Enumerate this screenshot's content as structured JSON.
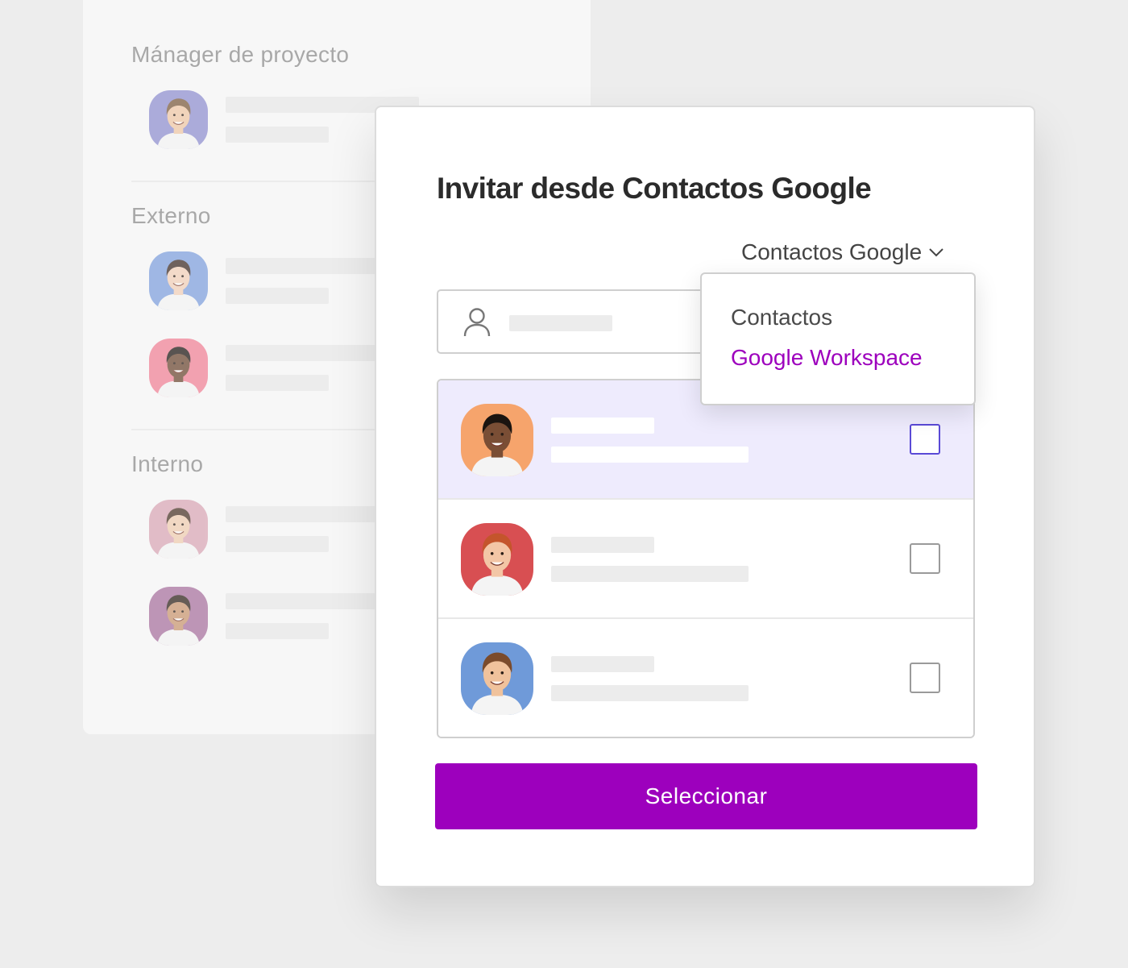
{
  "colors": {
    "brand": "#9d00bd",
    "selected_row": "#eeebfd",
    "checkbox_active": "#5a4ad6"
  },
  "background_panel": {
    "sections": [
      {
        "heading": "Mánager de proyecto",
        "people": [
          {
            "avatar_bg": "#8f8ed0",
            "hair": "#7a5a3c",
            "skin": "#f0c7a4"
          }
        ]
      },
      {
        "heading": "Externo",
        "people": [
          {
            "avatar_bg": "#7e9fdd",
            "hair": "#3b2a22",
            "skin": "#f2d0b8"
          },
          {
            "avatar_bg": "#f18095",
            "hair": "#1d1612",
            "skin": "#6b4630"
          }
        ]
      },
      {
        "heading": "Interno",
        "people": [
          {
            "avatar_bg": "#d9a6b5",
            "hair": "#4a3326",
            "skin": "#f0cdb0"
          },
          {
            "avatar_bg": "#a7709e",
            "hair": "#2e2119",
            "skin": "#c9966f"
          }
        ]
      }
    ]
  },
  "modal": {
    "title": "Invitar desde Contactos Google",
    "source_select": {
      "value": "Contactos Google",
      "icon": "chevron-down-icon"
    },
    "dropdown": {
      "options": [
        "Contactos",
        "Google Workspace"
      ],
      "active_index": 1
    },
    "search": {
      "icon": "user-icon"
    },
    "contacts": [
      {
        "avatar_bg": "#f6a46c",
        "hair": "#1b1410",
        "skin": "#7a4e35",
        "selected": true
      },
      {
        "avatar_bg": "#d84f52",
        "hair": "#c4552c",
        "skin": "#f3c6a6",
        "selected": false
      },
      {
        "avatar_bg": "#6f9ad9",
        "hair": "#7b4b2c",
        "skin": "#f0c29c",
        "selected": false
      }
    ],
    "primary_button": "Seleccionar"
  }
}
